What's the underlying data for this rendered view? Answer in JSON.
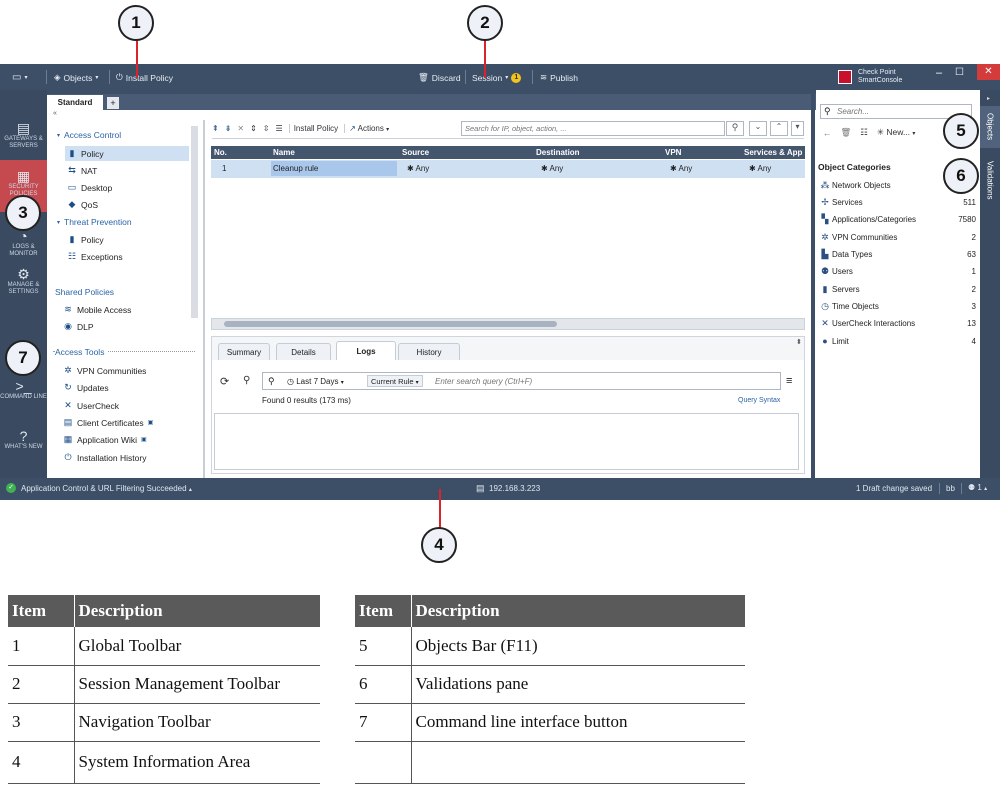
{
  "callouts": [
    "1",
    "2",
    "3",
    "4",
    "5",
    "6",
    "7"
  ],
  "global_toolbar": {
    "objects": "Objects",
    "install_policy": "Install Policy",
    "discard": "Discard",
    "session": "Session",
    "session_badge": "1",
    "publish": "Publish",
    "brand_line1": "Check Point",
    "brand_line2": "SmartConsole"
  },
  "navigation": [
    {
      "label": "GATEWAYS & SERVERS",
      "icon": "gateways-icon"
    },
    {
      "label": "SECURITY POLICIES",
      "icon": "security-policies-icon"
    },
    {
      "label": "LOGS & MONITOR",
      "icon": "logs-monitor-icon"
    },
    {
      "label": "MANAGE & SETTINGS",
      "icon": "manage-settings-icon"
    },
    {
      "label": "COMMAND LINE",
      "icon": "command-line-icon"
    },
    {
      "label": "WHAT'S NEW",
      "icon": "whats-new-icon"
    }
  ],
  "policy_tabs": {
    "active": "Standard",
    "add": "+"
  },
  "policy_tree": {
    "access_control": "Access Control",
    "access_items": [
      "Policy",
      "NAT",
      "Desktop",
      "QoS"
    ],
    "threat_prevention": "Threat Prevention",
    "threat_items": [
      "Policy",
      "Exceptions"
    ],
    "shared_policies": "Shared Policies",
    "shared_items": [
      "Mobile Access",
      "DLP"
    ],
    "access_tools": "Access Tools",
    "tools_items": [
      "VPN Communities",
      "Updates",
      "UserCheck",
      "Client Certificates",
      "Application Wiki",
      "Installation History"
    ]
  },
  "rulebase_toolbar": {
    "install_policy": "Install Policy",
    "actions": "Actions",
    "search_placeholder": "Search for IP, object, action, ..."
  },
  "rule_table": {
    "columns": [
      "No.",
      "Name",
      "Source",
      "Destination",
      "VPN",
      "Services & App"
    ],
    "rows": [
      {
        "no": "1",
        "name": "Cleanup rule",
        "source": "Any",
        "destination": "Any",
        "vpn": "Any",
        "services": "Any"
      }
    ]
  },
  "bottom_pane": {
    "tabs": [
      "Summary",
      "Details",
      "Logs",
      "History"
    ],
    "active_tab": "Logs",
    "time_filter": "Last 7 Days",
    "scope_filter": "Current Rule",
    "query_placeholder": "Enter search query (Ctrl+F)",
    "results": "Found 0 results (173 ms)",
    "query_syntax": "Query Syntax"
  },
  "objects_bar": {
    "search_placeholder": "Search...",
    "new_label": "New...",
    "categories_title": "Object Categories",
    "categories": [
      {
        "name": "Network Objects",
        "count": ""
      },
      {
        "name": "Services",
        "count": "511"
      },
      {
        "name": "Applications/Categories",
        "count": "7580"
      },
      {
        "name": "VPN Communities",
        "count": "2"
      },
      {
        "name": "Data Types",
        "count": "63"
      },
      {
        "name": "Users",
        "count": "1"
      },
      {
        "name": "Servers",
        "count": "2"
      },
      {
        "name": "Time Objects",
        "count": "3"
      },
      {
        "name": "UserCheck Interactions",
        "count": "13"
      },
      {
        "name": "Limit",
        "count": "4"
      }
    ],
    "side_tabs": [
      "Objects",
      "Validations"
    ]
  },
  "status_bar": {
    "message": "Application Control & URL Filtering Succeeded",
    "server_ip": "192.168.3.223",
    "drafts": "1 Draft change saved",
    "user": "bb",
    "sessions": "1"
  },
  "legend_left": {
    "headers": [
      "Item",
      "Description"
    ],
    "rows": [
      [
        "1",
        "Global Toolbar"
      ],
      [
        "2",
        "Session Management Toolbar"
      ],
      [
        "3",
        "Navigation Toolbar"
      ],
      [
        "4",
        "System Information Area"
      ]
    ]
  },
  "legend_right": {
    "headers": [
      "Item",
      "Description"
    ],
    "rows": [
      [
        "5",
        "Objects Bar (F11)"
      ],
      [
        "6",
        "Validations pane"
      ],
      [
        "7",
        "Command line interface button"
      ],
      [
        "",
        ""
      ]
    ]
  }
}
